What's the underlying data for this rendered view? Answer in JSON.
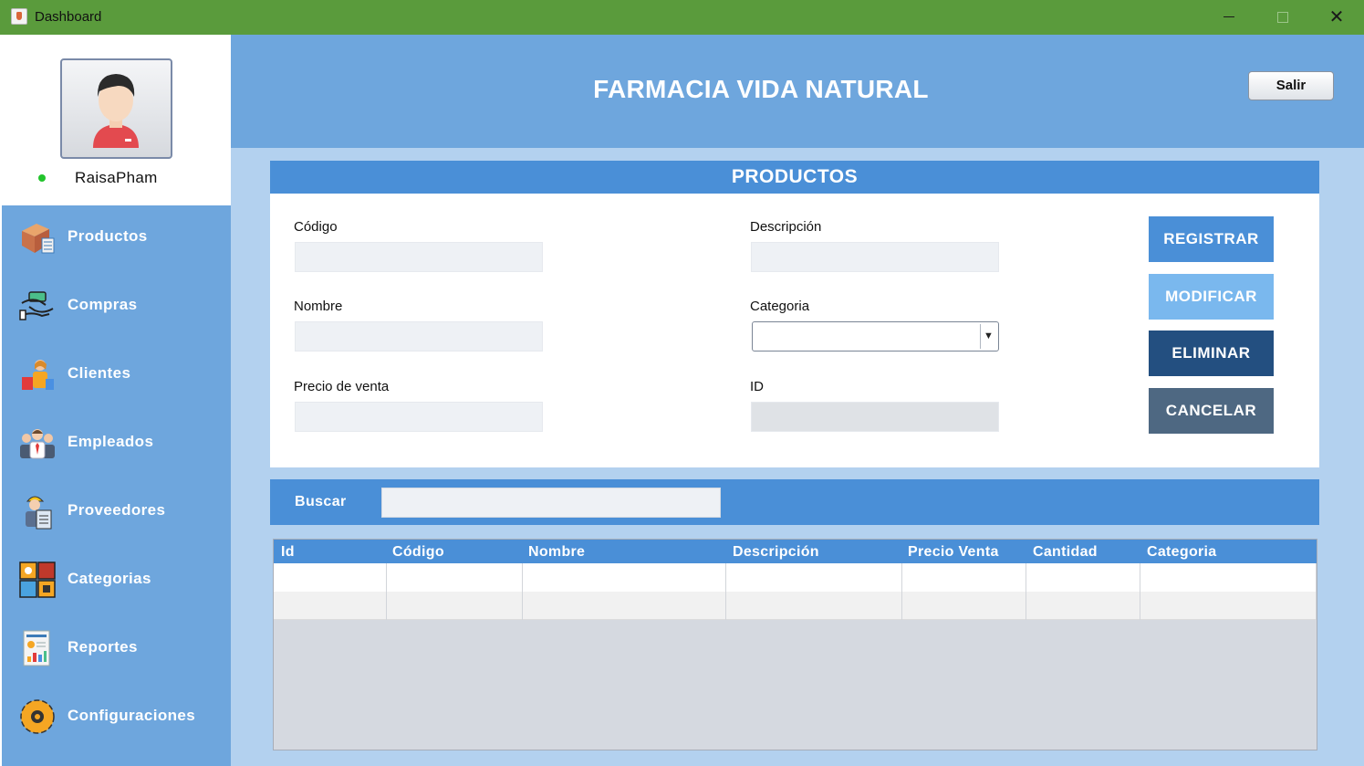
{
  "window": {
    "title": "Dashboard"
  },
  "user": {
    "name": "RaisaPham",
    "status": "online"
  },
  "sidebar": {
    "items": [
      {
        "label": "Productos",
        "icon": "box-icon"
      },
      {
        "label": "Compras",
        "icon": "money-hands-icon"
      },
      {
        "label": "Clientes",
        "icon": "customer-icon"
      },
      {
        "label": "Empleados",
        "icon": "team-icon"
      },
      {
        "label": "Proveedores",
        "icon": "supplier-icon"
      },
      {
        "label": "Categorias",
        "icon": "categories-icon"
      },
      {
        "label": "Reportes",
        "icon": "report-icon"
      },
      {
        "label": "Configuraciones",
        "icon": "gear-icon"
      }
    ]
  },
  "header": {
    "brand": "FARMACIA VIDA NATURAL",
    "exit_label": "Salir"
  },
  "form": {
    "title": "PRODUCTOS",
    "codigo": {
      "label": "Código",
      "value": ""
    },
    "descripcion": {
      "label": "Descripción",
      "value": ""
    },
    "nombre": {
      "label": "Nombre",
      "value": ""
    },
    "categoria": {
      "label": "Categoria",
      "value": ""
    },
    "precio": {
      "label": "Precio de venta",
      "value": ""
    },
    "id": {
      "label": "ID",
      "value": ""
    }
  },
  "actions": {
    "registrar": "REGISTRAR",
    "modificar": "MODIFICAR",
    "eliminar": "ELIMINAR",
    "cancelar": "CANCELAR"
  },
  "search": {
    "label": "Buscar",
    "value": ""
  },
  "table": {
    "columns": [
      "Id",
      "Código",
      "Nombre",
      "Descripción",
      "Precio Venta",
      "Cantidad",
      "Categoria"
    ],
    "rows": []
  },
  "colors": {
    "titlebar": "#5a9b3c",
    "sidebar": "#6ea6dd",
    "accent": "#4a8fd7",
    "registrar": "#4a8fd7",
    "modificar": "#7ab8ee",
    "eliminar": "#234f80",
    "cancelar": "#4e6882"
  }
}
